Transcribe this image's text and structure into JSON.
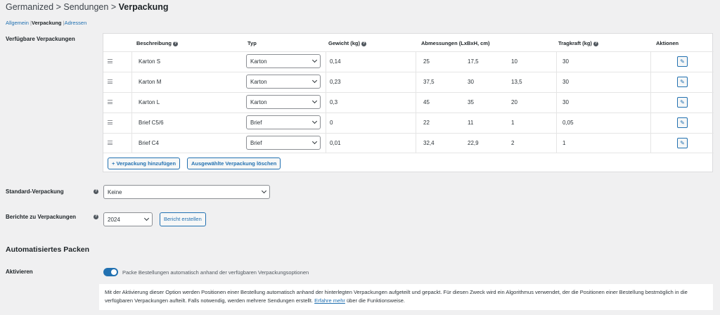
{
  "breadcrumb": {
    "part1": "Germanized",
    "sep": ">",
    "part2": "Sendungen",
    "current": "Verpackung"
  },
  "subnav": {
    "item1": "Allgemein",
    "item2": "Verpackung",
    "item3": "Adressen",
    "sep": "|"
  },
  "section_available": {
    "label": "Verfügbare Verpackungen"
  },
  "table": {
    "headers": {
      "description": "Beschreibung",
      "type": "Typ",
      "weight": "Gewicht (kg)",
      "dimensions": "Abmessungen (LxBxH, cm)",
      "capacity": "Tragkraft (kg)",
      "actions": "Aktionen"
    },
    "rows": [
      {
        "description": "Karton S",
        "type": "Karton",
        "weight": "0,14",
        "length": "25",
        "width": "17,5",
        "height": "10",
        "capacity": "30"
      },
      {
        "description": "Karton M",
        "type": "Karton",
        "weight": "0,23",
        "length": "37,5",
        "width": "30",
        "height": "13,5",
        "capacity": "30"
      },
      {
        "description": "Karton L",
        "type": "Karton",
        "weight": "0,3",
        "length": "45",
        "width": "35",
        "height": "20",
        "capacity": "30"
      },
      {
        "description": "Brief C5/6",
        "type": "Brief",
        "weight": "0",
        "length": "22",
        "width": "11",
        "height": "1",
        "capacity": "0,05"
      },
      {
        "description": "Brief C4",
        "type": "Brief",
        "weight": "0,01",
        "length": "32,4",
        "width": "22,9",
        "height": "2",
        "capacity": "1"
      }
    ],
    "add_button": "+ Verpackung hinzufügen",
    "delete_button": "Ausgewählte Verpackung löschen",
    "edit_icon": "pencil-icon"
  },
  "default_packaging": {
    "label": "Standard-Verpackung",
    "value": "Keine"
  },
  "reports": {
    "label": "Berichte zu Verpackungen",
    "year": "2024",
    "button": "Bericht erstellen"
  },
  "auto_pack": {
    "heading": "Automatisiertes Packen",
    "label": "Aktivieren",
    "toggle_on": true,
    "toggle_text": "Packe Bestellungen automatisch anhand der verfügbaren Verpackungsoptionen",
    "description": "Mit der Aktivierung dieser Option werden Positionen einer Bestellung automatisch anhand der hinterlegten Verpackungen aufgeteilt und gepackt. Für diesen Zweck wird ein Algorithmus verwendet, der die Positionen einer Bestellung bestmöglich in die verfügbaren Verpackungen aufteilt. Falls notwendig, werden mehrere Sendungen erstellt.",
    "link": "Erfahre mehr",
    "description_end": "über die Funktionsweise."
  },
  "colors": {
    "accent": "#2271b1",
    "background": "#f0f0f1",
    "panel": "#ffffff"
  }
}
